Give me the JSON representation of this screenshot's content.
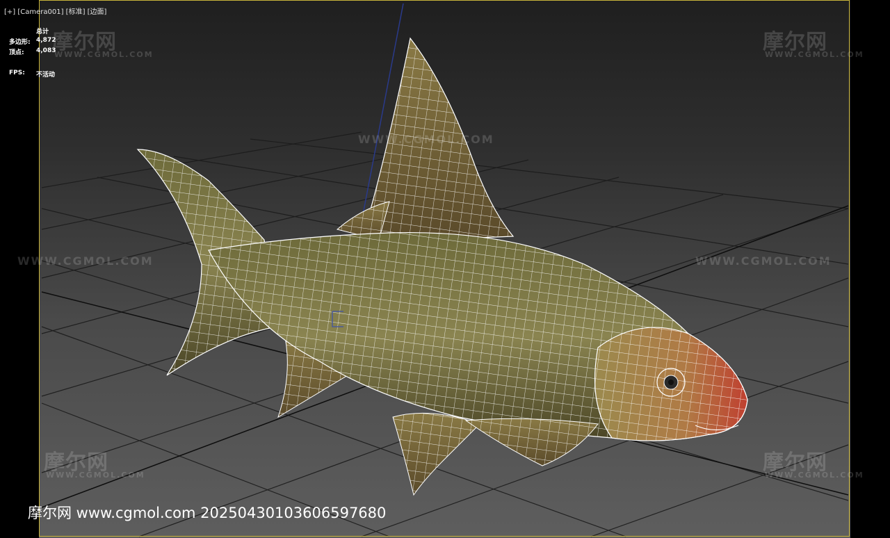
{
  "viewport": {
    "label": "[+] [Camera001] [标准] [边面]",
    "stats": {
      "header": "总计",
      "polygons_label": "多边形:",
      "polygons_value": "4,872",
      "vertices_label": "顶点:",
      "vertices_value": "4,083",
      "fps_label": "FPS:",
      "fps_value": "不活动"
    },
    "frame_color": "#c8b43a"
  },
  "watermarks": {
    "cn": "摩尔网",
    "url": "WWW.CGMOL.COM",
    "url_small": "WWW.CGMOL.COM"
  },
  "caption": {
    "text": "摩尔网 www.cgmol.com 20250430103606597680"
  },
  "icons": {
    "axis_gizmo": "axis-gizmo-icon",
    "pivot": "pivot-icon"
  }
}
